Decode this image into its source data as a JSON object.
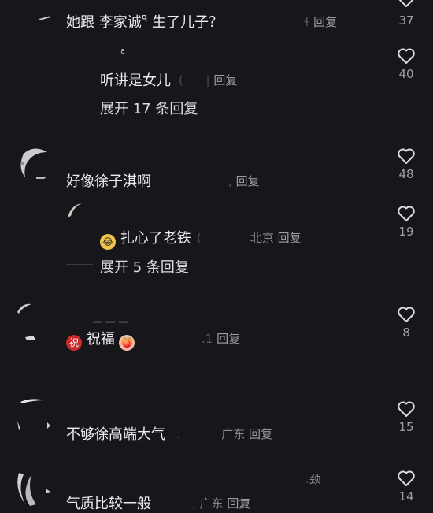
{
  "comments": [
    {
      "text": "她跟 李家诚",
      "text2": "生了儿子？",
      "meta": "回复",
      "likes": "37"
    },
    {
      "text": "听讲是女儿",
      "meta": "回复",
      "likes": "40",
      "expand": "展开 17 条回复"
    },
    {
      "text": "好像徐子淇啊",
      "meta": "回复",
      "likes": "48"
    },
    {
      "text": "扎心了老铁",
      "location": "北京",
      "meta": "回复",
      "likes": "19",
      "expand": "展开 5 条回复"
    },
    {
      "text": "祝福",
      "meta": "回复",
      "likes": "8"
    },
    {
      "text": "不够徐高端大气",
      "location": "广东",
      "meta": "回复",
      "likes": "15"
    },
    {
      "text": "气质比较一般",
      "location": "广东",
      "meta": "回复",
      "likes": "14",
      "extra": "颈"
    }
  ],
  "emoji": {
    "zhu": "祝"
  },
  "icons": {
    "like": "heart-outline-icon"
  }
}
